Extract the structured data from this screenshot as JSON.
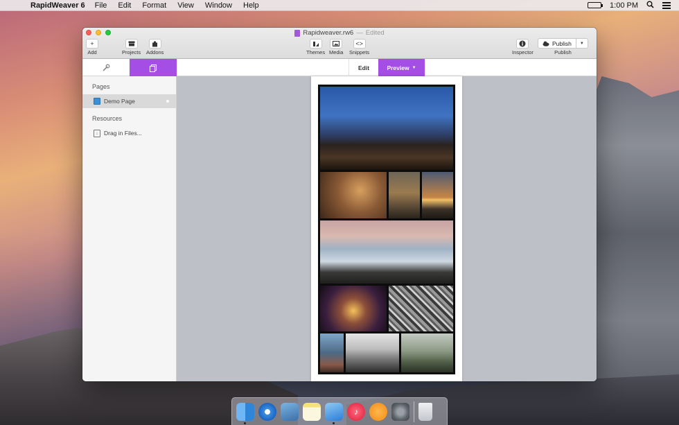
{
  "menubar": {
    "apple": "",
    "app_name": "RapidWeaver 6",
    "menus": [
      "File",
      "Edit",
      "Format",
      "View",
      "Window",
      "Help"
    ],
    "clock": "1:00 PM"
  },
  "window": {
    "title": "Rapidweaver.rw6",
    "separator": "—",
    "status": "Edited",
    "toolbar": {
      "add": "Add",
      "projects": "Projects",
      "addons": "Addons",
      "themes": "Themes",
      "media": "Media",
      "snippets": "Snippets",
      "inspector": "Inspector",
      "publish_button": "Publish",
      "publish_label": "Publish"
    },
    "modes": {
      "edit": "Edit",
      "preview": "Preview"
    },
    "sidebar": {
      "pages_heading": "Pages",
      "pages": [
        "Demo Page"
      ],
      "resources_heading": "Resources",
      "resources_drop": "Drag in Files..."
    }
  },
  "colors": {
    "accent": "#a44ee6"
  }
}
